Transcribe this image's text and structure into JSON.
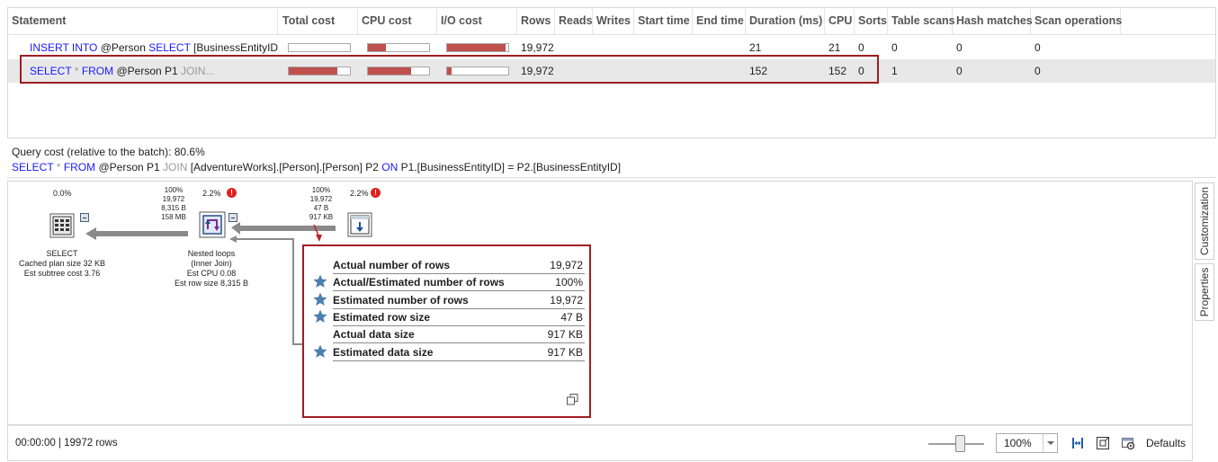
{
  "grid": {
    "columns": [
      "Statement",
      "Total cost",
      "CPU cost",
      "I/O cost",
      "Rows",
      "Reads",
      "Writes",
      "Start time",
      "End time",
      "Duration (ms)",
      "CPU",
      "Sorts",
      "Table scans",
      "Hash matches",
      "Scan operations"
    ],
    "rows": [
      {
        "stmt_kw1": "INSERT INTO",
        "stmt_mid": " @Person ",
        "stmt_kw2": "SELECT",
        "stmt_rest": " [BusinessEntityID],...",
        "total_cost_fill": 0.0,
        "cpu_cost_fill": 0.3,
        "io_cost_fill": 0.95,
        "rows": "19,972",
        "reads": "",
        "writes": "",
        "start": "",
        "end": "",
        "duration": "21",
        "cpu": "21",
        "sorts": "0",
        "table_scans": "0",
        "hash_matches": "0",
        "scan_ops": "0"
      },
      {
        "stmt_kw1": "SELECT",
        "stmt_star": " * ",
        "stmt_kw2": "FROM",
        "stmt_mid": " @Person P1 ",
        "stmt_dim": "JOIN...",
        "total_cost_fill": 0.8,
        "cpu_cost_fill": 0.7,
        "io_cost_fill": 0.08,
        "rows": "19,972",
        "reads": "",
        "writes": "",
        "start": "",
        "end": "",
        "duration": "152",
        "cpu": "152",
        "sorts": "0",
        "table_scans": "1",
        "hash_matches": "0",
        "scan_ops": "0"
      }
    ]
  },
  "query": {
    "cost_label": "Query cost (relative to the batch):  80.6%",
    "kw_select": "SELECT",
    "star": " * ",
    "kw_from": "FROM",
    "part1": " @Person P1 ",
    "kw_join": "JOIN",
    "part2": " [AdventureWorks].[Person].[Person] P2 ",
    "kw_on": "ON",
    "part3": " P1.[BusinessEntityID] = P2.[BusinessEntityID]"
  },
  "plan": {
    "select_node": {
      "pct": "0.0%",
      "lines": [
        "SELECT",
        "Cached plan size  32 KB",
        "Est subtree cost  3.76"
      ]
    },
    "nested_node": {
      "stats": [
        "100%",
        "19,972",
        "8,315 B",
        "158 MB"
      ],
      "pct": "2.2%",
      "lines": [
        "Nested loops",
        "(Inner Join)",
        "Est CPU  0.08",
        "Est row size  8,315 B"
      ]
    },
    "scan_node": {
      "stats": [
        "100%",
        "19,972",
        "47 B",
        "917 KB"
      ],
      "pct": "2.2%"
    },
    "warning_glyph": "!"
  },
  "tooltip": {
    "rows": [
      {
        "label": "Actual number of rows",
        "value": "19,972",
        "star": false
      },
      {
        "label": "Actual/Estimated number of rows",
        "value": "100%",
        "star": true
      },
      {
        "label": "Estimated number of rows",
        "value": "19,972",
        "star": true
      },
      {
        "label": "Estimated row size",
        "value": "47 B",
        "star": true
      },
      {
        "label": "Actual data size",
        "value": "917 KB",
        "star": false
      },
      {
        "label": "Estimated data size",
        "value": "917 KB",
        "star": true
      }
    ]
  },
  "footer": {
    "status": "00:00:00 | 19972 rows",
    "zoom": "100%",
    "defaults": "Defaults"
  },
  "side": {
    "tab1": "Customization",
    "tab2": "Properties"
  },
  "colors": {
    "accent_red": "#a01d22",
    "bar_red": "#c0504d",
    "keyword_blue": "#1a1aff",
    "star_blue": "#4a7fb0"
  }
}
